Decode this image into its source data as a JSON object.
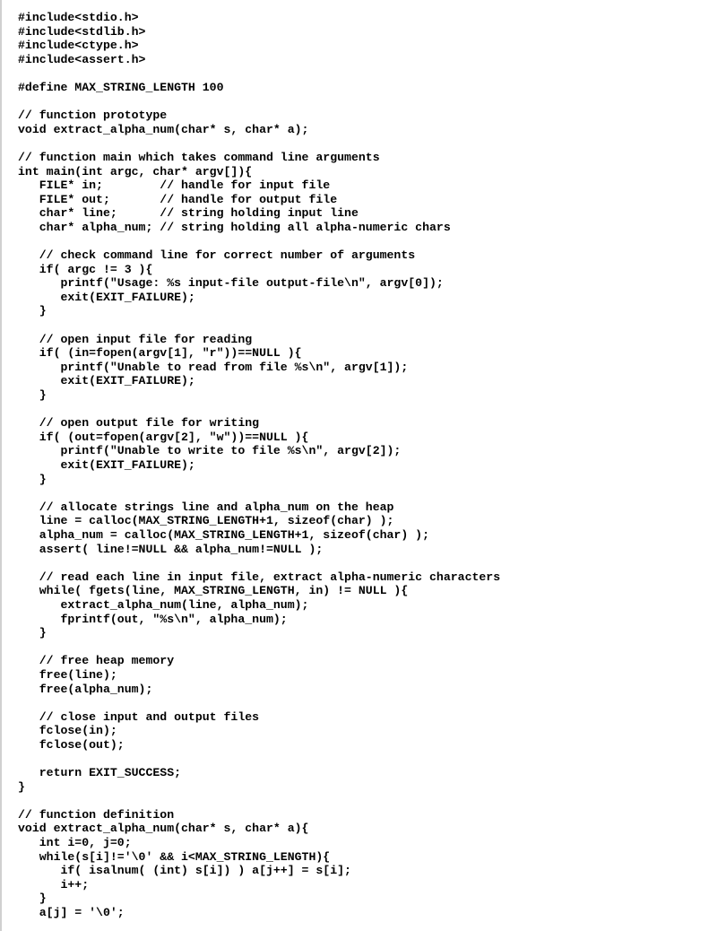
{
  "code": {
    "lines": [
      "#include<stdio.h>",
      "#include<stdlib.h>",
      "#include<ctype.h>",
      "#include<assert.h>",
      "",
      "#define MAX_STRING_LENGTH 100",
      "",
      "// function prototype",
      "void extract_alpha_num(char* s, char* a);",
      "",
      "// function main which takes command line arguments",
      "int main(int argc, char* argv[]){",
      "   FILE* in;        // handle for input file",
      "   FILE* out;       // handle for output file",
      "   char* line;      // string holding input line",
      "   char* alpha_num; // string holding all alpha-numeric chars",
      "",
      "   // check command line for correct number of arguments",
      "   if( argc != 3 ){",
      "      printf(\"Usage: %s input-file output-file\\n\", argv[0]);",
      "      exit(EXIT_FAILURE);",
      "   }",
      "",
      "   // open input file for reading",
      "   if( (in=fopen(argv[1], \"r\"))==NULL ){",
      "      printf(\"Unable to read from file %s\\n\", argv[1]);",
      "      exit(EXIT_FAILURE);",
      "   }",
      "",
      "   // open output file for writing",
      "   if( (out=fopen(argv[2], \"w\"))==NULL ){",
      "      printf(\"Unable to write to file %s\\n\", argv[2]);",
      "      exit(EXIT_FAILURE);",
      "   }",
      "",
      "   // allocate strings line and alpha_num on the heap",
      "   line = calloc(MAX_STRING_LENGTH+1, sizeof(char) );",
      "   alpha_num = calloc(MAX_STRING_LENGTH+1, sizeof(char) );",
      "   assert( line!=NULL && alpha_num!=NULL );",
      "",
      "   // read each line in input file, extract alpha-numeric characters",
      "   while( fgets(line, MAX_STRING_LENGTH, in) != NULL ){",
      "      extract_alpha_num(line, alpha_num);",
      "      fprintf(out, \"%s\\n\", alpha_num);",
      "   }",
      "",
      "   // free heap memory",
      "   free(line);",
      "   free(alpha_num);",
      "",
      "   // close input and output files",
      "   fclose(in);",
      "   fclose(out);",
      "",
      "   return EXIT_SUCCESS;",
      "}",
      "",
      "// function definition",
      "void extract_alpha_num(char* s, char* a){",
      "   int i=0, j=0;",
      "   while(s[i]!='\\0' && i<MAX_STRING_LENGTH){",
      "      if( isalnum( (int) s[i]) ) a[j++] = s[i];",
      "      i++;",
      "   }",
      "   a[j] = '\\0';"
    ]
  }
}
